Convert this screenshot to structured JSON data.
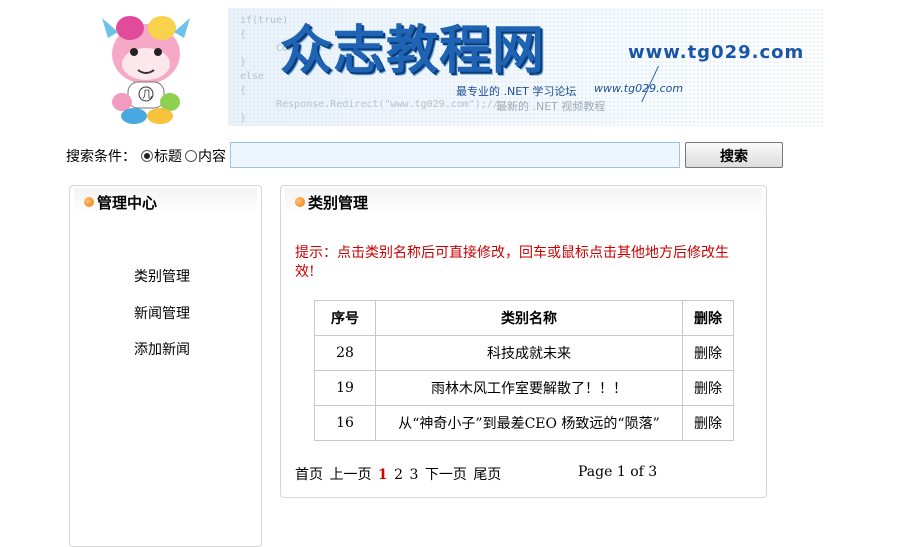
{
  "header": {
    "code_lines": [
      "if(true)",
      "{",
      "      Cons",
      "}",
      "else",
      "{",
      "      Response.Redirect(\"www.tg029.com\");//",
      "}"
    ],
    "brand_title": "众志教程网",
    "brand_url": "www.tg029.com",
    "slogan": "最专业的 .NET 学习论坛",
    "slogan_site": "www.tg029.com",
    "tagline": "最新的 .NET 视频教程"
  },
  "search": {
    "label": "搜索条件：",
    "option_title": "标题",
    "option_content": "内容",
    "selected": "标题",
    "input_value": "",
    "button_label": "搜索"
  },
  "sidebar": {
    "title": "管理中心",
    "items": [
      {
        "label": "类别管理"
      },
      {
        "label": "新闻管理"
      },
      {
        "label": "添加新闻"
      }
    ]
  },
  "main": {
    "title": "类别管理",
    "hint": "提示：点击类别名称后可直接修改，回车或鼠标点击其他地方后修改生效!",
    "table": {
      "headers": [
        "序号",
        "类别名称",
        "删除"
      ],
      "rows": [
        {
          "id": "28",
          "name": "科技成就未来",
          "action": "删除"
        },
        {
          "id": "19",
          "name": "雨林木风工作室要解散了！！！",
          "action": "删除"
        },
        {
          "id": "16",
          "name": "从“神奇小子”到最差CEO 杨致远的“陨落”",
          "action": "删除"
        }
      ]
    },
    "pager": {
      "first": "首页",
      "prev": "上一页",
      "pages": [
        "1",
        "2",
        "3"
      ],
      "current": "1",
      "next": "下一页",
      "last": "尾页",
      "info": "Page 1 of 3"
    }
  },
  "colors": {
    "hint_red": "#cc0000",
    "brand_blue": "#1e63b4",
    "accent_orange": "#f07a00"
  }
}
